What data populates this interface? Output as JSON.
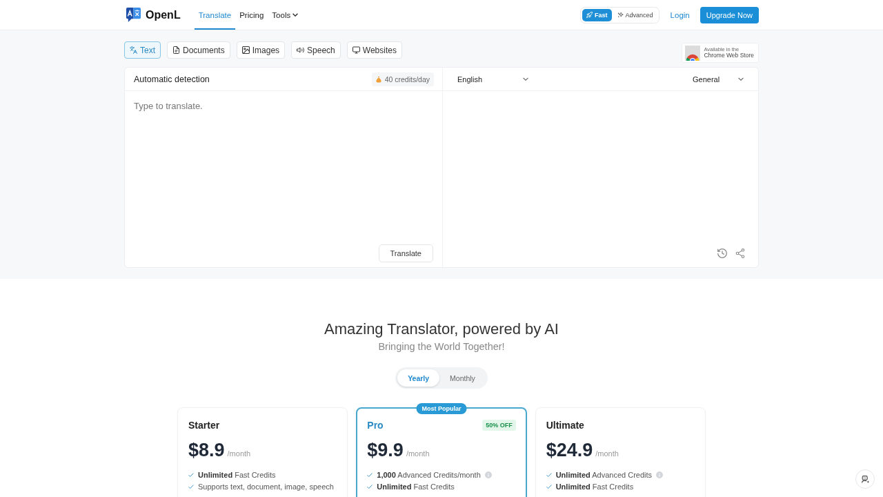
{
  "header": {
    "brand": "OpenL",
    "nav": [
      {
        "label": "Translate",
        "kind": "link",
        "selected": true
      },
      {
        "label": "Pricing",
        "kind": "link",
        "selected": false
      },
      {
        "label": "Tools",
        "kind": "dropdown",
        "selected": false
      }
    ],
    "modes": [
      {
        "label": "Fast",
        "selected": true
      },
      {
        "label": "Advanced",
        "selected": false
      }
    ],
    "login": "Login",
    "upgrade_button": "Upgrade Now"
  },
  "input_tabs": [
    {
      "label": "Text",
      "selected": true
    },
    {
      "label": "Documents",
      "selected": false
    },
    {
      "label": "Images",
      "selected": false
    },
    {
      "label": "Speech",
      "selected": false
    },
    {
      "label": "Websites",
      "selected": false
    }
  ],
  "store_badge": {
    "line_1": "Available in the",
    "line_2": "Chrome Web Store"
  },
  "translator": {
    "source_language": "Automatic detection",
    "credits": "40 credits/day",
    "placeholder": "Type to translate.",
    "translate_button": "Translate",
    "target_language": "English",
    "style": "General"
  },
  "pricing": {
    "title": "Amazing Translator, powered by AI",
    "subtitle": "Bringing the World Together!",
    "billing": [
      {
        "label": "Yearly",
        "selected": true
      },
      {
        "label": "Monthly",
        "selected": false
      }
    ],
    "plans": [
      {
        "name": "Starter",
        "highlighted": false,
        "price": "$8.9",
        "period": "/month",
        "features": [
          {
            "text": "**Unlimited** Fast Credits",
            "info": false
          },
          {
            "text": "Supports text, document, image, speech",
            "info": false
          }
        ]
      },
      {
        "name": "Pro",
        "highlighted": true,
        "ribbon": "Most Popular",
        "discount": "50% OFF",
        "price": "$9.9",
        "period": "/month",
        "features": [
          {
            "text": "**1,000** Advanced Credits/month",
            "info": true
          },
          {
            "text": "**Unlimited** Fast Credits",
            "info": false
          }
        ]
      },
      {
        "name": "Ultimate",
        "highlighted": false,
        "price": "$24.9",
        "period": "/month",
        "features": [
          {
            "text": "**Unlimited** Advanced Credits",
            "info": true
          },
          {
            "text": "**Unlimited** Fast Credits",
            "info": false
          }
        ]
      }
    ]
  }
}
